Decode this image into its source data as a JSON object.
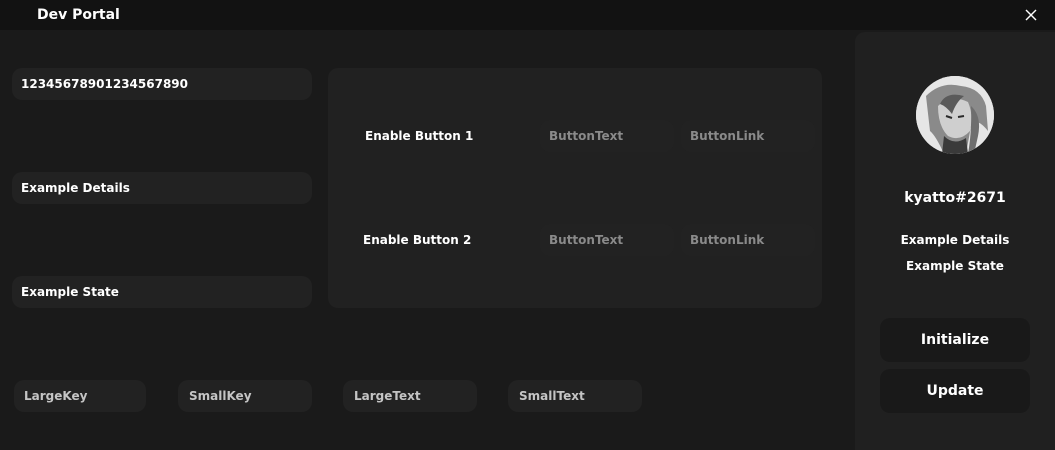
{
  "window": {
    "title": "Dev Portal",
    "close_icon": "close-icon"
  },
  "fields": {
    "client_id": "12345678901234567890",
    "details": "Example Details",
    "state": "Example State"
  },
  "assets": {
    "large_key": "LargeKey",
    "small_key": "SmallKey",
    "large_text": "LargeText",
    "small_text": "SmallText"
  },
  "buttons_panel": {
    "button1": {
      "toggle_label": "Enable Button 1",
      "text_placeholder": "ButtonText",
      "link_placeholder": "ButtonLink"
    },
    "button2": {
      "toggle_label": "Enable Button 2",
      "text_placeholder": "ButtonText",
      "link_placeholder": "ButtonLink"
    }
  },
  "profile": {
    "username": "kyatto#2671",
    "details": "Example Details",
    "state": "Example State"
  },
  "actions": {
    "initialize": "Initialize",
    "update": "Update"
  },
  "colors": {
    "background": "#1a1a1a",
    "titlebar": "#121212",
    "field": "#222222",
    "panel": "#212121",
    "button": "#191919"
  }
}
